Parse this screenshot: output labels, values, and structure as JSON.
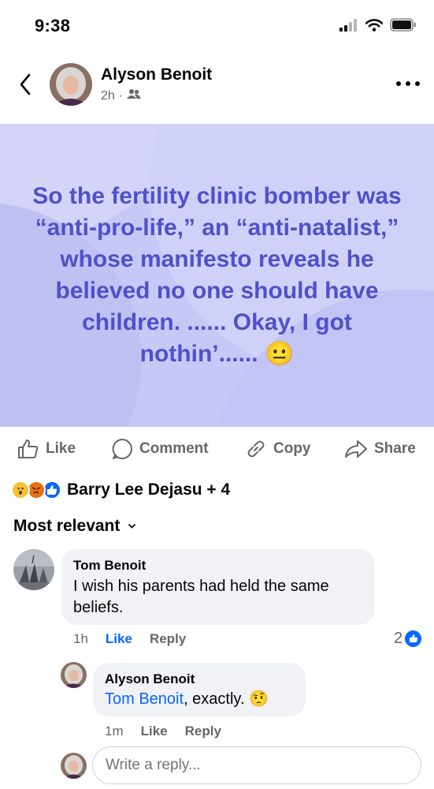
{
  "status_bar": {
    "time": "9:38"
  },
  "post": {
    "author": "Alyson Benoit",
    "time": "2h",
    "separator": "·",
    "text": "So the fertility clinic bomber was “anti-pro-life,” an “anti-natalist,” whose manifesto reveals he believed no one should have children. ...... Okay, I got nothin’...... 😐",
    "background_color": "#c6c8f6",
    "text_color": "#5150c9"
  },
  "actions": {
    "like": "Like",
    "comment": "Comment",
    "copy": "Copy",
    "share": "Share"
  },
  "reactions": {
    "icons": [
      "wow-icon",
      "angry-icon",
      "like-icon"
    ],
    "summary": "Barry Lee Dejasu + 4"
  },
  "sort": {
    "label": "Most relevant"
  },
  "comments": [
    {
      "author": "Tom Benoit",
      "text": "I wish his parents had held the same beliefs.",
      "time": "1h",
      "like_label": "Like",
      "reply_label": "Reply",
      "reaction_count": "2",
      "replies": [
        {
          "author": "Alyson Benoit",
          "mention": "Tom Benoit",
          "text": ", exactly. 🤨",
          "time": "1m",
          "like_label": "Like",
          "reply_label": "Reply"
        }
      ]
    }
  ],
  "reply_input": {
    "placeholder": "Write a reply..."
  },
  "colors": {
    "accent": "#0866ff",
    "secondary_text": "#65676b",
    "bubble": "#f0f2f5"
  }
}
